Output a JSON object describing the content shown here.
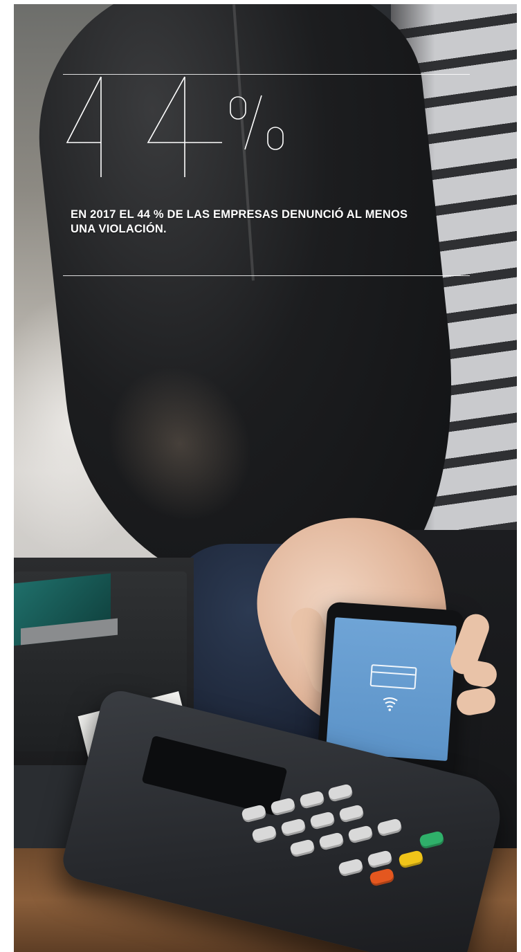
{
  "stat": {
    "value": "44",
    "unit": "%",
    "caption": "EN 2017 EL 44 % DE LAS EMPRESAS DENUNCIÓ AL MENOS UNA VIOLACIÓN."
  },
  "colors": {
    "text": "#ffffff",
    "rule": "#ffffff",
    "phone_screen": "#6fa4d6"
  },
  "icons": [
    "card-icon",
    "contactless-icon"
  ]
}
